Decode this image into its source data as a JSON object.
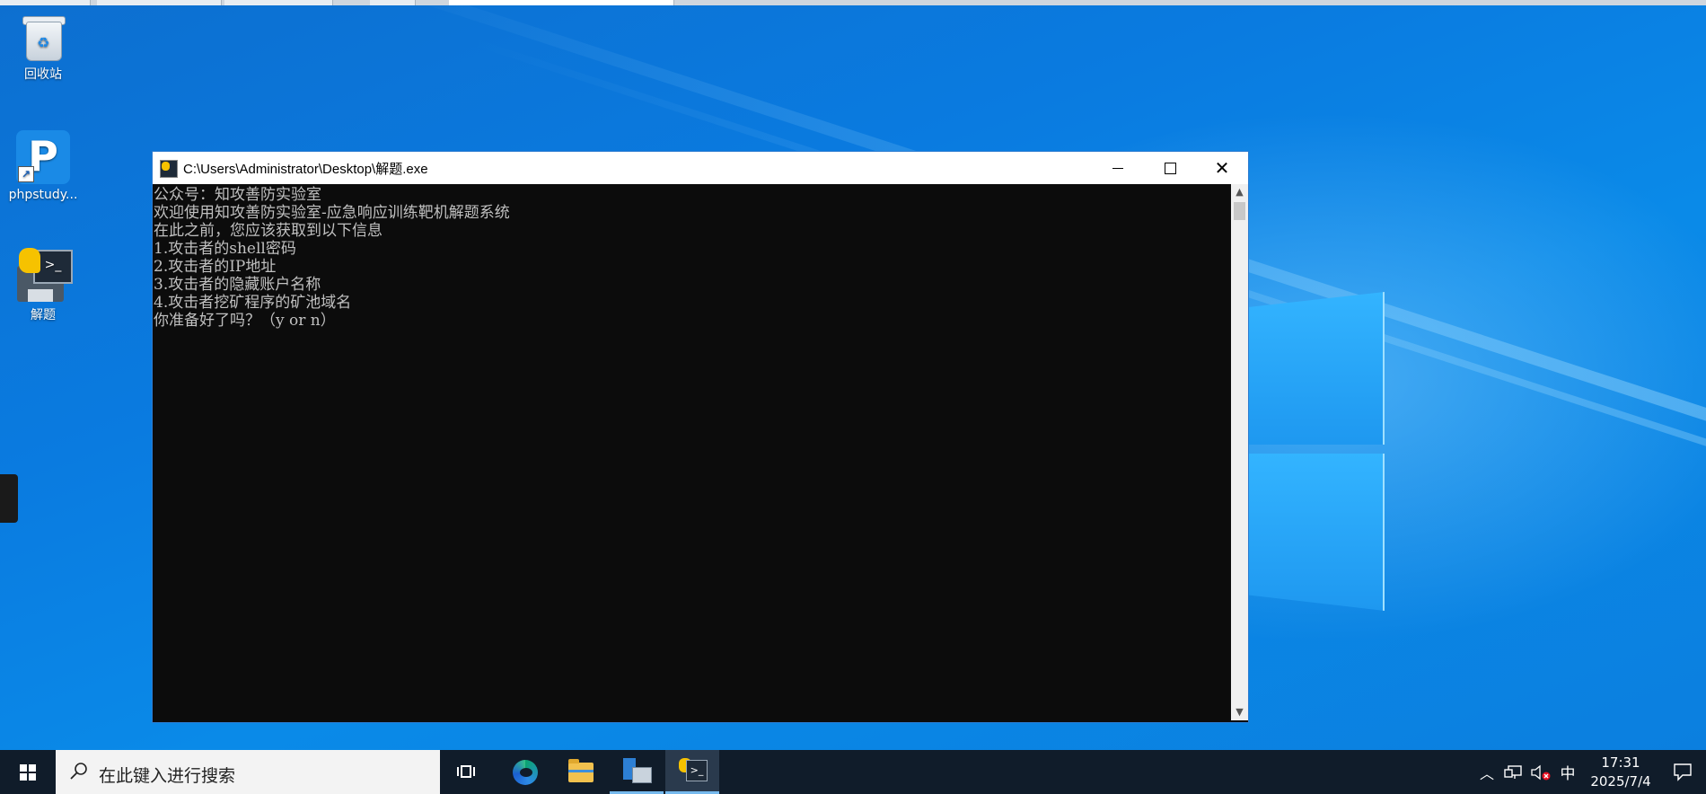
{
  "desktop": {
    "icons": [
      {
        "label": "回收站",
        "icon": "recycle-bin-icon"
      },
      {
        "label": "phpstudy...",
        "icon": "phpstudy-icon"
      },
      {
        "label": "解题",
        "icon": "python-exe-icon"
      }
    ]
  },
  "console_window": {
    "title": "C:\\Users\\Administrator\\Desktop\\解题.exe",
    "lines": [
      "公众号：知攻善防实验室",
      "欢迎使用知攻善防实验室-应急响应训练靶机解题系统",
      "在此之前，您应该获取到以下信息",
      "1.攻击者的shell密码",
      "2.攻击者的IP地址",
      "3.攻击者的隐藏账户名称",
      "4.攻击者挖矿程序的矿池域名",
      "你准备好了吗？（y or n）"
    ],
    "colors": {
      "background": "#0c0c0c",
      "text": "#c0c0c0"
    }
  },
  "taskbar": {
    "search_placeholder": "在此键入进行搜索",
    "apps": [
      "task-view-icon",
      "edge-icon",
      "file-explorer-icon",
      "server-manager-icon",
      "python-console-icon"
    ],
    "tray": {
      "ime": "中",
      "time": "17:31",
      "date": "2025/7/4"
    }
  }
}
